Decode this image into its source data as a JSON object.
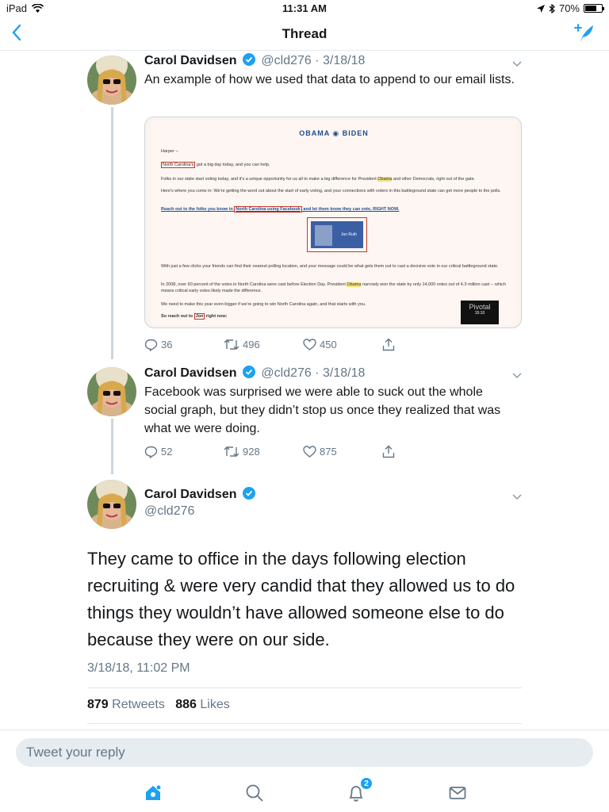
{
  "status_bar": {
    "device": "iPad",
    "time": "11:31 AM",
    "battery": "70%",
    "battery_level": 0.7
  },
  "nav": {
    "title": "Thread"
  },
  "tweets": [
    {
      "name": "Carol Davidsen",
      "handle": "@cld276",
      "date": "· 3/18/18",
      "text": "An example of how we used that data to append to our email lists.",
      "replies": "36",
      "retweets": "496",
      "likes": "450"
    },
    {
      "name": "Carol Davidsen",
      "handle": "@cld276",
      "date": "· 3/18/18",
      "text": "Facebook was surprised we were able to suck out the whole social graph, but they didn’t stop us once they realized that was what we were doing.",
      "replies": "52",
      "retweets": "928",
      "likes": "875"
    }
  ],
  "email_card": {
    "logo": "OBAMA ◉ BIDEN",
    "greeting": "Harper --",
    "state_hl": "North Carolina's",
    "line1_rest": " got a big day today, and you can help.",
    "line2_a": "Folks in our state start voting today, and it's a unique opportunity for us all to make a big difference for President ",
    "line2_obama": "Obama",
    "line2_b": " and other Democrats, right out of the gate.",
    "line3": "Here's where you come in: We're getting the word out about the start of early voting, and your connections with voters in this battleground state can get more people to the polls.",
    "link_a": "Reach out to the folks you know in ",
    "link_hl": "North Carolina using Facebook",
    "link_b": " and let them know they can vote, RIGHT NOW.",
    "friend_name": "Jon Ruth",
    "line4": "With just a few clicks your friends can find their nearest polling location, and your message could be what gets them out to cast a decisive vote in our critical battleground state.",
    "line5_a": "In 2008, over 60 percent of the votes in North Carolina were cast before Election Day. President ",
    "line5_obama": "Obama",
    "line5_b": " narrowly won the state by only 14,000 votes out of 4.3 million cast -- which means critical early votes likely made the difference.",
    "line6": "We need to make this year even bigger if we're going to win North Carolina again, and that starts with you.",
    "line7_a": "So reach out to ",
    "line7_hl": "Jon",
    "line7_b": " right now:",
    "watermark": "Pivotal",
    "watermark_time": "15:10"
  },
  "main_tweet": {
    "name": "Carol Davidsen",
    "handle": "@cld276",
    "text": "They came to office in the days following election recruiting &  were very candid that they allowed us to do things they wouldn’t have allowed someone else to do because they were on our side.",
    "timestamp": "3/18/18, 11:02 PM",
    "retweets_count": "879",
    "retweets_label": "Retweets",
    "likes_count": "886",
    "likes_label": "Likes"
  },
  "reply": {
    "placeholder": "Tweet your reply"
  },
  "tabbar": {
    "notifications_badge": "2"
  },
  "colors": {
    "accent": "#1da1f2",
    "text": "#14171a",
    "muted": "#657786"
  }
}
